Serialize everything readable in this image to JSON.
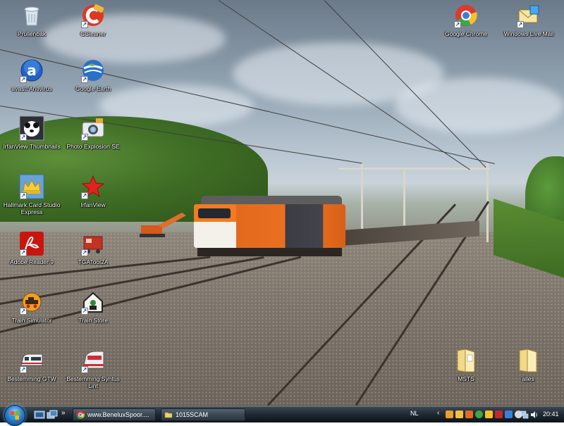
{
  "desktop": {
    "icons": [
      {
        "label": "Prullenbak",
        "icon": "recycle-bin-icon"
      },
      {
        "label": "CCleaner",
        "icon": "ccleaner-icon"
      },
      {
        "label": "Google Chrome",
        "icon": "chrome-icon"
      },
      {
        "label": "Windows Live Mail",
        "icon": "windows-live-mail-icon"
      },
      {
        "label": "avast! Antivirus",
        "icon": "avast-icon"
      },
      {
        "label": "Google Earth",
        "icon": "google-earth-icon"
      },
      {
        "label": "IrfanView Thumbnails",
        "icon": "irfanview-thumbnails-icon"
      },
      {
        "label": "Photo Explosion SE",
        "icon": "photo-explosion-icon"
      },
      {
        "label": "Hallmark Card Studio Express",
        "icon": "hallmark-crown-icon"
      },
      {
        "label": "IrfanView",
        "icon": "irfanview-icon"
      },
      {
        "label": "Adobe Reader 9",
        "icon": "adobe-reader-icon"
      },
      {
        "label": "TGATool2A",
        "icon": "tga-tool-icon"
      },
      {
        "label": "Train Simulator",
        "icon": "train-simulator-icon"
      },
      {
        "label": "Train Store",
        "icon": "train-store-icon"
      },
      {
        "label": "Bestemming GTW",
        "icon": "gtw-train-icon"
      },
      {
        "label": "Bestemming Syntus Lint",
        "icon": "syntus-lint-train-icon"
      },
      {
        "label": "MSTS",
        "icon": "folder-icon"
      },
      {
        "label": "alles",
        "icon": "folder-icon"
      }
    ]
  },
  "taskbar": {
    "start_label": "Start",
    "overflow_label": "»",
    "tasks": [
      {
        "label": "www.BeneluxSpoor....",
        "icon": "chrome-icon"
      },
      {
        "label": "1015SCAM",
        "icon": "folder-icon"
      }
    ],
    "tray": {
      "language": "NL",
      "clock": "20:41"
    }
  },
  "colors": {
    "taskbar": "#1e2830",
    "loco_orange": "#e96f20",
    "label_text": "#ffffff"
  }
}
